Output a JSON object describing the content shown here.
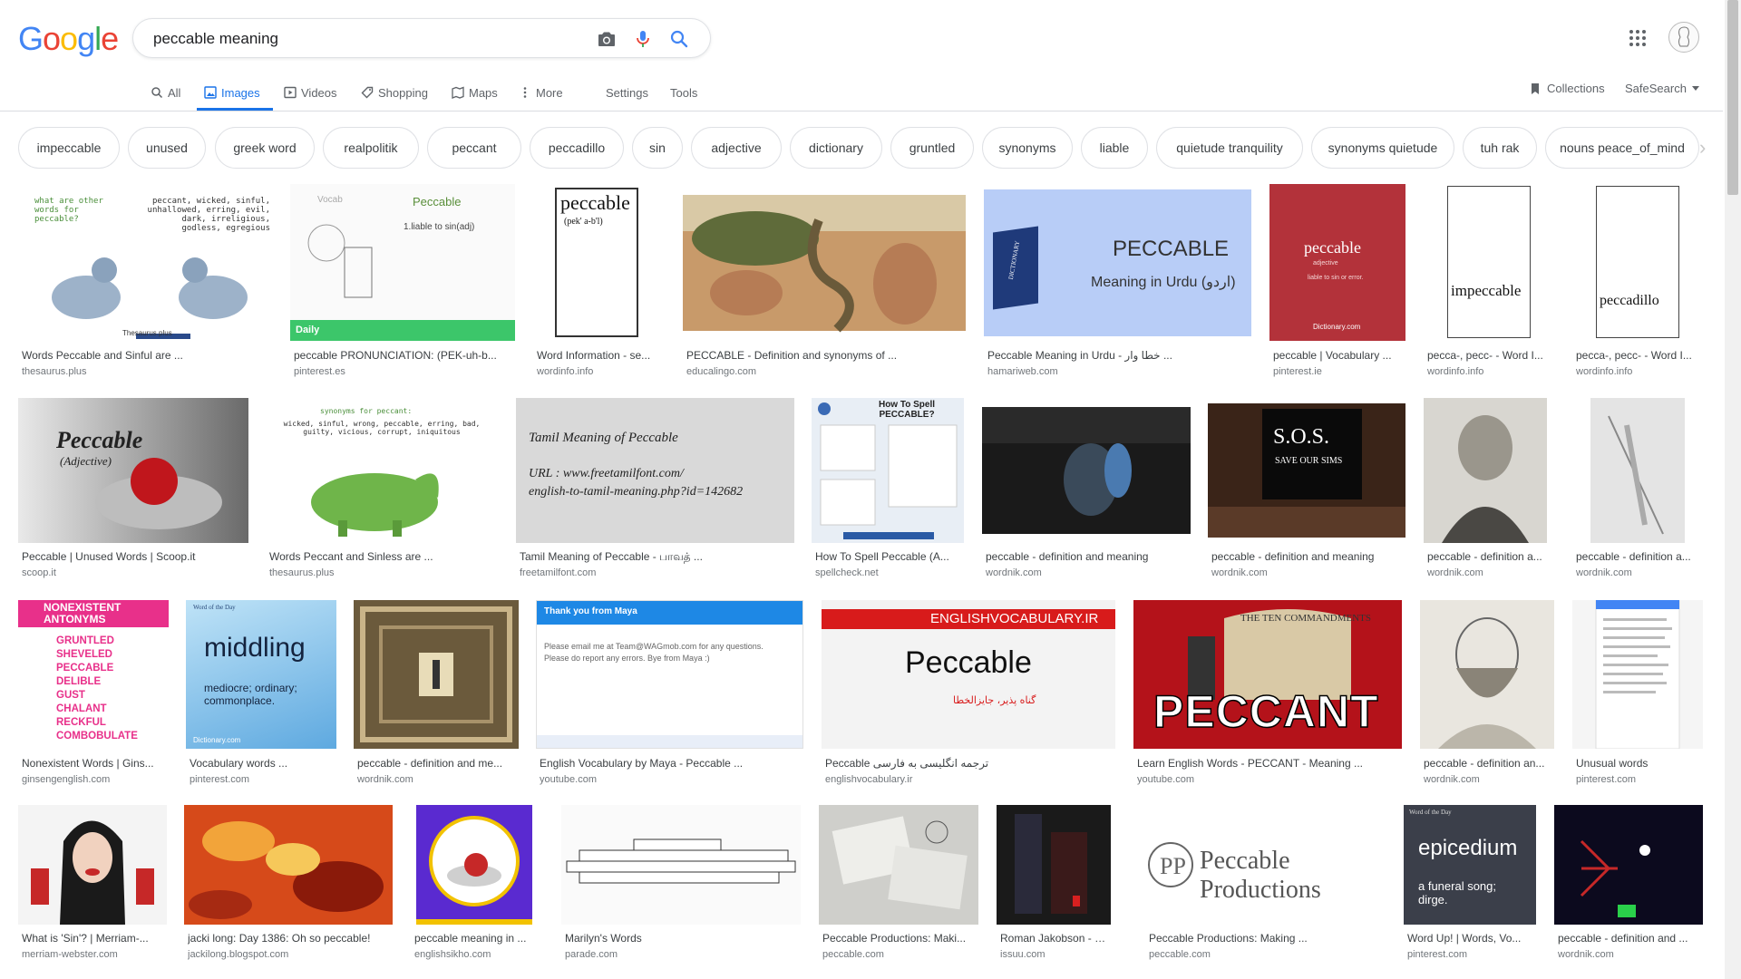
{
  "logo": {
    "letters": [
      "G",
      "o",
      "o",
      "g",
      "l",
      "e"
    ],
    "colors": [
      "#4285F4",
      "#EA4335",
      "#FBBC05",
      "#4285F4",
      "#34A853",
      "#EA4335"
    ]
  },
  "search": {
    "query": "peccable meaning",
    "icons": [
      "camera-icon",
      "microphone-icon",
      "search-icon"
    ]
  },
  "header_icons": [
    "apps-grid-icon",
    "account-avatar"
  ],
  "tabs": [
    {
      "label": "All",
      "icon": "search-icon"
    },
    {
      "label": "Images",
      "icon": "image-icon",
      "active": true
    },
    {
      "label": "Videos",
      "icon": "play-icon"
    },
    {
      "label": "Shopping",
      "icon": "tag-icon"
    },
    {
      "label": "Maps",
      "icon": "map-icon"
    },
    {
      "label": "More",
      "icon": "more-vertical-icon"
    },
    {
      "label": "Settings"
    },
    {
      "label": "Tools"
    }
  ],
  "right_links": {
    "collections": "Collections",
    "safesearch": "SafeSearch"
  },
  "chips": [
    "impeccable",
    "unused",
    "greek word",
    "realpolitik",
    "peccant",
    "peccadillo",
    "sin",
    "adjective",
    "dictionary",
    "gruntled",
    "synonyms",
    "liable",
    "quietude tranquility",
    "synonyms quietude",
    "tuh rak",
    "nouns peace_of_mind"
  ],
  "results": [
    {
      "title": "Words Peccable and Sinful are ...",
      "domain": "thesaurus.plus"
    },
    {
      "title": "peccable PRONUNCIATION: (PEK-uh-b...",
      "domain": "pinterest.es"
    },
    {
      "title": "Word Information - se...",
      "domain": "wordinfo.info"
    },
    {
      "title": "PECCABLE - Definition and synonyms of ...",
      "domain": "educalingo.com"
    },
    {
      "title": "Peccable Meaning in Urdu - خطا وار ...",
      "domain": "hamariweb.com"
    },
    {
      "title": "peccable | Vocabulary ...",
      "domain": "pinterest.ie"
    },
    {
      "title": "pecca-, pecc- - Word I...",
      "domain": "wordinfo.info"
    },
    {
      "title": "pecca-, pecc- - Word I...",
      "domain": "wordinfo.info"
    },
    {
      "title": "Peccable | Unused Words | Scoop.it",
      "domain": "scoop.it"
    },
    {
      "title": "Words Peccant and Sinless are ...",
      "domain": "thesaurus.plus"
    },
    {
      "title": "Tamil Meaning of Peccable - பாவத் ...",
      "domain": "freetamilfont.com"
    },
    {
      "title": "How To Spell Peccable (A...",
      "domain": "spellcheck.net"
    },
    {
      "title": "peccable - definition and meaning",
      "domain": "wordnik.com"
    },
    {
      "title": "peccable - definition and meaning",
      "domain": "wordnik.com"
    },
    {
      "title": "peccable - definition a...",
      "domain": "wordnik.com"
    },
    {
      "title": "peccable - definition a...",
      "domain": "wordnik.com"
    },
    {
      "title": "Nonexistent Words | Gins...",
      "domain": "ginsengenglish.com"
    },
    {
      "title": "Vocabulary words ...",
      "domain": "pinterest.com"
    },
    {
      "title": "peccable - definition and me...",
      "domain": "wordnik.com"
    },
    {
      "title": "English Vocabulary by Maya - Peccable ...",
      "domain": "youtube.com"
    },
    {
      "title": "Peccable ترجمه انگلیسی به فارسی",
      "domain": "englishvocabulary.ir"
    },
    {
      "title": "Learn English Words - PECCANT - Meaning ...",
      "domain": "youtube.com"
    },
    {
      "title": "peccable - definition an...",
      "domain": "wordnik.com"
    },
    {
      "title": "Unusual words",
      "domain": "pinterest.com"
    },
    {
      "title": "What is 'Sin'? | Merriam-...",
      "domain": "merriam-webster.com"
    },
    {
      "title": "jacki long: Day 1386: Oh so peccable!",
      "domain": "jackilong.blogspot.com"
    },
    {
      "title": "peccable meaning in ...",
      "domain": "englishsikho.com"
    },
    {
      "title": "Marilyn's Words",
      "domain": "parade.com"
    },
    {
      "title": "Peccable Productions: Maki...",
      "domain": "peccable.com"
    },
    {
      "title": "Roman Jakobson - Six...",
      "domain": "issuu.com"
    },
    {
      "title": "Peccable Productions: Making ...",
      "domain": "peccable.com"
    },
    {
      "title": "Word Up! | Words, Vo...",
      "domain": "pinterest.com"
    },
    {
      "title": "peccable - definition and ...",
      "domain": "wordnik.com"
    }
  ],
  "thumb_text": {
    "t1_left": "what are other words for peccable?",
    "t1_right": "peccant, wicked, sinful, unhallowed, erring, evil, dark, irreligious, godless, egregious",
    "t1_badge": "Thesaurus.plus",
    "t2_word": "Peccable",
    "t2_def": "1.liable to sin(adj)",
    "t2_daily": "Daily",
    "t2_vocab": "Vocab",
    "t3_word": "peccable",
    "t3_pron": "(pek' a-b'l)",
    "t5_word": "PECCABLE",
    "t5_sub": "Meaning in Urdu (اردو)",
    "t5_book": "DICTIONARY",
    "t6_word": "peccable",
    "t6_pos": "adjective",
    "t6_def": "liable to sin or error.",
    "t6_brand": "Dictionary.com",
    "t7_word": "impeccable",
    "t8_word": "peccadillo",
    "t9_word": "Peccable",
    "t9_pos": "(Adjective)",
    "t10_head": "synonyms for peccant:",
    "t10_body": "wicked, sinful, wrong, peccable, erring, bad, guilty, vicious, corrupt, iniquitous",
    "t11_l1": "Tamil Meaning of Peccable",
    "t11_l2": "URL : www.freetamilfont.com/",
    "t11_l3": "english-to-tamil-meaning.php?id=142682",
    "t12_head": "How To Spell PECCABLE?",
    "t14_sign1": "S.O.S.",
    "t14_sign2": "SAVE OUR SIMS",
    "t17_head": "NONEXISTENT ANTONYMS",
    "t17_words": [
      "GRUNTLED",
      "SHEVELED",
      "PECCABLE",
      "DELIBLE",
      "GUST",
      "CHALANT",
      "RECKFUL",
      "COMBOBULATE"
    ],
    "t18_word": "middling",
    "t18_def": "mediocre; ordinary; commonplace.",
    "t18_top": "Word of the Day",
    "t18_brand": "Dictionary.com",
    "t20_head": "Thank you from Maya",
    "t20_body": "Please email me at Team@WAGmob.com for any questions. Please do report any errors. Bye from Maya :)",
    "t21_top": "ENGLISHVOCABULARY.IR",
    "t21_word": "Peccable",
    "t21_fa": "گناه پذیر، جایزالخطا",
    "t22_word": "PECCANT",
    "t22_tablet": "THE TEN COMMANDMENTS",
    "t31_logo": "Peccable Productions",
    "t32_word": "epicedium",
    "t32_def": "a funeral song; dirge.",
    "t32_top": "Word of the Day"
  },
  "colors": {
    "link_blue": "#1a73e8",
    "text_gray": "#5f6368",
    "domain_gray": "#70757a",
    "chip_border": "#dfe1e5"
  }
}
